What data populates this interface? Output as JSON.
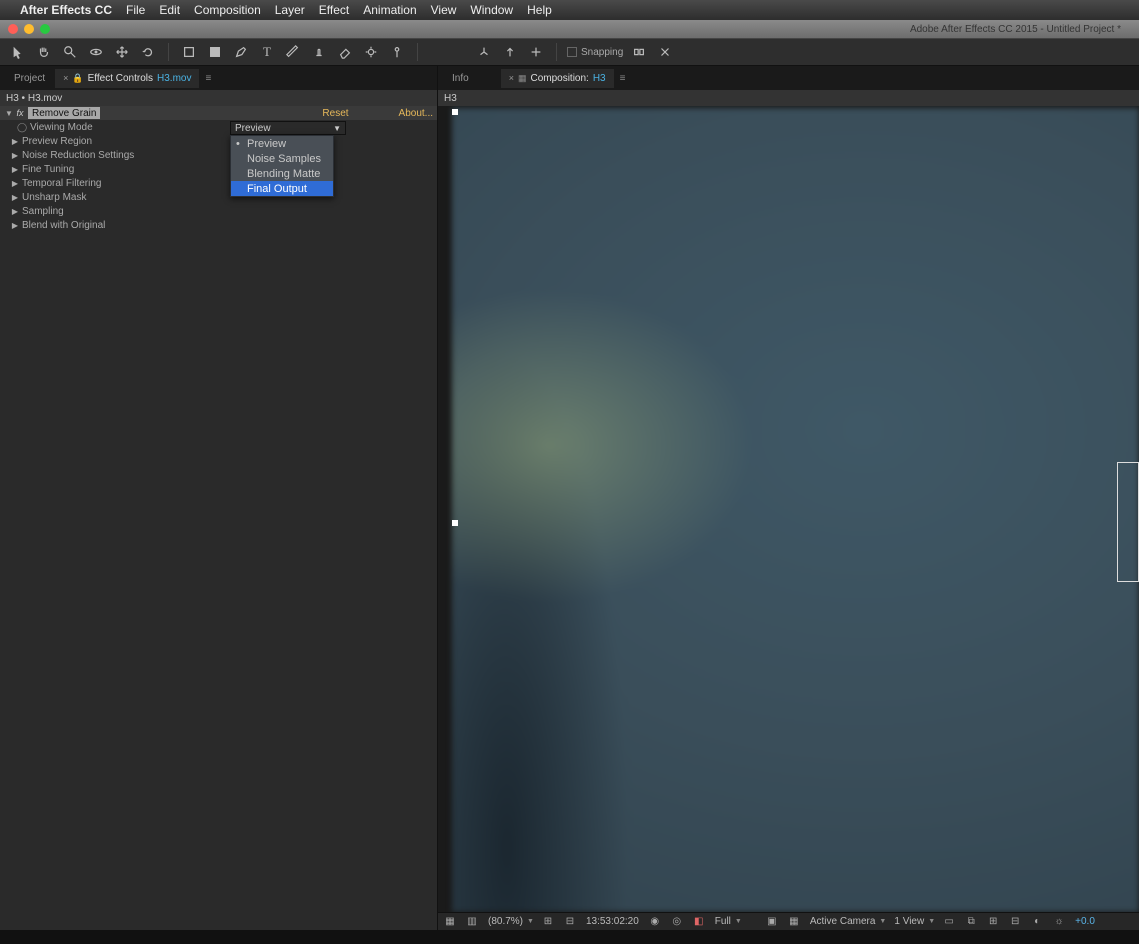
{
  "menubar": {
    "app": "After Effects CC",
    "items": [
      "File",
      "Edit",
      "Composition",
      "Layer",
      "Effect",
      "Animation",
      "View",
      "Window",
      "Help"
    ]
  },
  "window": {
    "title": "Adobe After Effects CC 2015 - Untitled Project *"
  },
  "toolbar": {
    "snapping_label": "Snapping"
  },
  "left": {
    "project_tab": "Project",
    "effect_tab_prefix": "Effect Controls",
    "effect_tab_clip": "H3.mov",
    "breadcrumb": "H3 • H3.mov",
    "effect": {
      "name": "Remove Grain",
      "reset": "Reset",
      "about": "About...",
      "viewing_mode_label": "Viewing Mode",
      "viewing_mode_value": "Preview",
      "props": [
        "Preview Region",
        "Noise Reduction Settings",
        "Fine Tuning",
        "Temporal Filtering",
        "Unsharp Mask",
        "Sampling",
        "Blend with Original"
      ]
    },
    "dropdown": {
      "options": [
        "Preview",
        "Noise Samples",
        "Blending Matte",
        "Final Output"
      ],
      "checked_index": 0,
      "hover_index": 3
    }
  },
  "right": {
    "info_tab": "Info",
    "comp_tab_prefix": "Composition:",
    "comp_name": "H3",
    "sub_tab": "H3"
  },
  "viewer_footer": {
    "zoom": "(80.7%)",
    "timecode": "13:53:02:20",
    "res": "Full",
    "camera": "Active Camera",
    "views": "1 View",
    "exposure": "+0.0"
  }
}
